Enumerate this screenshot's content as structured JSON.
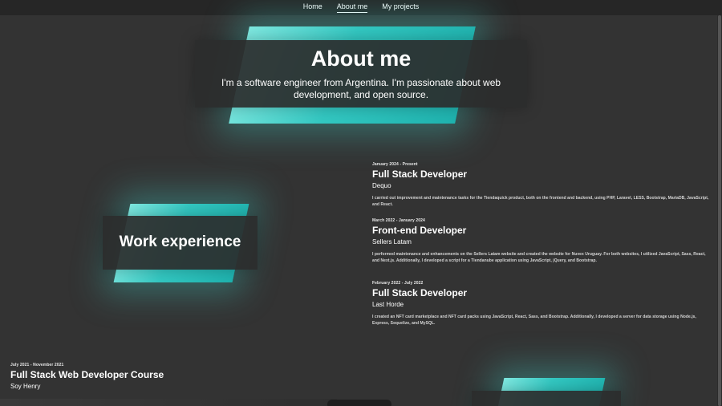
{
  "nav": {
    "items": [
      {
        "label": "Home"
      },
      {
        "label": "About me"
      },
      {
        "label": "My projects"
      }
    ],
    "active_index": 1
  },
  "hero": {
    "title": "About me",
    "subtitle": "I'm a software engineer from Argentina. I'm passionate about web development, and open source."
  },
  "work": {
    "title": "Work experience",
    "entries": [
      {
        "date": "January 2024 - Present",
        "role": "Full Stack Developer",
        "company": "Dequo",
        "description": "I carried out improvement and maintenance tasks for the Tiendaquick product, both on the frontend and backend, using PHP, Laravel, LESS, Bootstrap, MariaDB, JavaScript, and React."
      },
      {
        "date": "March 2022 - January 2024",
        "role": "Front-end Developer",
        "company": "Sellers Latam",
        "description": "I performed maintenance and enhancements on the Sellers Latam website and created the website for Nuvex Uruguay. For both websites, I utilized JavaScript, Sass, React, and Next.js. Additionally, I developed a script for a Tiendanube application using JavaScript, jQuery, and Bootstrap."
      },
      {
        "date": "February 2022 - July 2022",
        "role": "Full Stack Developer",
        "company": "Last Horde",
        "description": "I created an NFT card marketplace and NFT card packs using JavaScript, React, Sass, and Bootstrap. Additionally, I developed a server for data storage using Node.js, Express, Sequelize, and MySQL."
      }
    ]
  },
  "education": {
    "entries": [
      {
        "date": "July 2021 - November 2021",
        "title": "Full Stack Web Developer Course",
        "institution": "Soy Henry"
      }
    ]
  },
  "colors": {
    "background": "#333333",
    "nav_background": "#262626",
    "accent": "#33c8c2"
  }
}
